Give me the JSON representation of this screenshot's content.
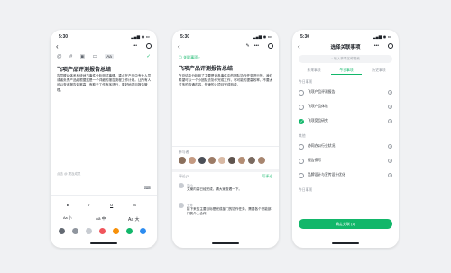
{
  "colors": {
    "accent": "#12b76a",
    "text": "#1f2329",
    "muted": "#8f959e"
  },
  "screen1": {
    "time": "5:30",
    "toolbar": [
      "@",
      "#",
      "image-icon",
      "folder-icon",
      "Aa",
      "✓"
    ],
    "title": "飞项产品评测报告总结",
    "body": "告员联动体系系统地方事件分析测试事情。重点在产品中专业人员或者负责产品组根据这是一个详细的报告流程工作计划。让所有人可以查询报告效率高，有助于工作有序进行，更好地项目报告管理。",
    "hint": "点击 @ 提及成员",
    "format": {
      "b": "B",
      "i": "I",
      "u": "U",
      "s": "S",
      "aa_small": "Aa 小",
      "aa_mid": "Aa 中",
      "aa_big": "Aa 大"
    },
    "swatches": [
      "#646a73",
      "#8f959e",
      "#c8ccd2",
      "#f0555c",
      "#f79009",
      "#12b76a",
      "#2d8cf0"
    ]
  },
  "screen2": {
    "time": "5:30",
    "doc_link": "关联事项",
    "title": "飞项产品评测报告总结",
    "body": "在总结中分析到了主要是对各事件中的团队协作任务进行的，我们希望可以一个小团队去协作完成工作，尽可能的提高效率，不要太过多的沟通内容，快速的让项目完成验收。",
    "participants_label": "参与者",
    "comments_label": "评论(3)",
    "comment_action": "写评论",
    "comments": [
      {
        "name": "刘小",
        "text": "文案内容已经完成，请大家查看一下。"
      },
      {
        "name": "王芳",
        "text": "接下来的主要目标是完成部门的协作任务，需要各个职能部门的介入合作。"
      }
    ]
  },
  "screen3": {
    "time": "5:30",
    "title": "选择关联事项",
    "search_placeholder": "输入事项名称搜索",
    "tabs": [
      "未来事项",
      "今日事项",
      "历史事项"
    ],
    "group1": "今日事项",
    "items": [
      {
        "label": "飞项产品评测报告",
        "checked": false
      },
      {
        "label": "飞项产品体验",
        "checked": false
      },
      {
        "label": "飞项竞品研究",
        "checked": true
      }
    ],
    "group2": "其他",
    "items2": [
      {
        "label": "协同办公行业状况",
        "checked": false
      },
      {
        "label": "报告撰写",
        "checked": false
      },
      {
        "label": "品牌设计与宣传设计优化",
        "checked": false
      }
    ],
    "group3": "今日事项",
    "confirm": "确定关联 (1)"
  }
}
